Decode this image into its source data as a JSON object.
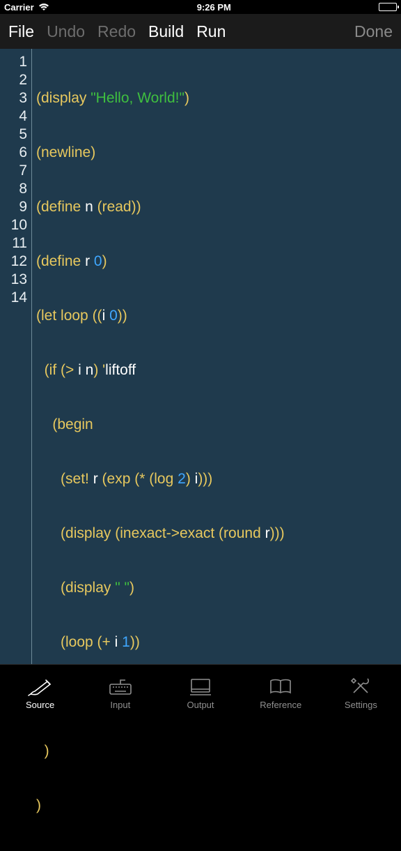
{
  "status": {
    "carrier": "Carrier",
    "time": "9:26 PM"
  },
  "toolbar": {
    "file": "File",
    "undo": "Undo",
    "redo": "Redo",
    "build": "Build",
    "run": "Run",
    "done": "Done"
  },
  "line_numbers": [
    "1",
    "2",
    "3",
    "4",
    "5",
    "6",
    "7",
    "8",
    "9",
    "10",
    "11",
    "12",
    "13",
    "14"
  ],
  "code": {
    "l1": {
      "a": "(",
      "b": "display",
      "c": " ",
      "d": "\"Hello, World!\"",
      "e": ")"
    },
    "l2": {
      "a": "(",
      "b": "newline",
      "c": ")"
    },
    "l3": {
      "a": "(",
      "b": "define",
      "c": " ",
      "d": "n",
      "e": " (",
      "f": "read",
      "g": "))"
    },
    "l4": {
      "a": "(",
      "b": "define",
      "c": " ",
      "d": "r",
      "e": " ",
      "f": "0",
      "g": ")"
    },
    "l5": {
      "a": "(",
      "b": "let",
      "c": " ",
      "d": "loop",
      "e": " ((",
      "f": "i",
      "g": " ",
      "h": "0",
      "i": "))"
    },
    "l6": {
      "indent": "  ",
      "a": "(",
      "b": "if",
      "c": " (",
      "d": ">",
      "e": " ",
      "f": "i",
      "g": " ",
      "h": "n",
      "i": ") '",
      "j": "liftoff"
    },
    "l7": {
      "indent": "    ",
      "a": "(",
      "b": "begin"
    },
    "l8": {
      "indent": "      ",
      "a": "(",
      "b": "set!",
      "c": " ",
      "d": "r",
      "e": " (",
      "f": "exp",
      "g": " (",
      "h": "*",
      "i": " (",
      "j": "log",
      "k": " ",
      "l": "2",
      "m": ") ",
      "n": "i",
      "o": ")))"
    },
    "l9": {
      "indent": "      ",
      "a": "(",
      "b": "display",
      "c": " (",
      "d": "inexact->exact",
      "e": " (",
      "f": "round",
      "g": " ",
      "h": "r",
      "i": ")))"
    },
    "l10": {
      "indent": "      ",
      "a": "(",
      "b": "display",
      "c": " ",
      "d": "\" \"",
      "e": ")"
    },
    "l11": {
      "indent": "      ",
      "a": "(",
      "b": "loop",
      "c": " (",
      "d": "+",
      "e": " ",
      "f": "i",
      "g": " ",
      "h": "1",
      "i": "))"
    },
    "l12": {
      "indent": "    ",
      "a": ")"
    },
    "l13": {
      "indent": "  ",
      "a": ")"
    },
    "l14": {
      "a": ")"
    }
  },
  "tabs": {
    "source": "Source",
    "input": "Input",
    "output": "Output",
    "reference": "Reference",
    "settings": "Settings"
  }
}
